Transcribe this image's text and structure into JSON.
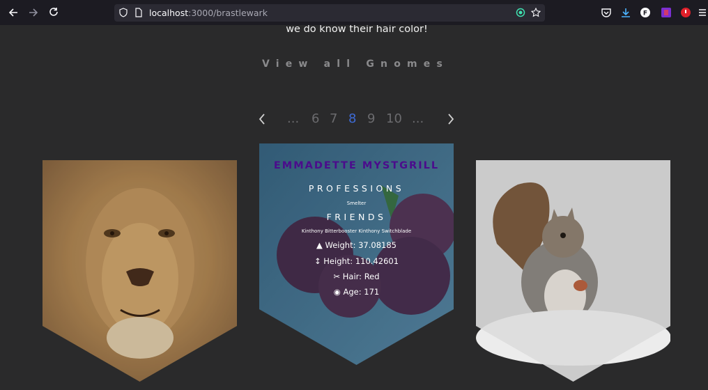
{
  "browser": {
    "url_host": "localhost",
    "url_rest": ":3000/brastlewark"
  },
  "page": {
    "lead_text": "we do know their hair color!",
    "view_all_label": "View all Gnomes"
  },
  "pagination": {
    "prev_icon": "chevron-left-icon",
    "next_icon": "chevron-right-icon",
    "items": [
      "...",
      "6",
      "7",
      "8",
      "9",
      "10",
      "..."
    ],
    "active": "8"
  },
  "cards": {
    "left": {
      "image": "lion photo"
    },
    "center": {
      "name": "EMMADETTE MYSTGRILL",
      "professions_title": "PROFESSIONS",
      "professions": "Smelter",
      "friends_title": "FRIENDS",
      "friends": "Kinthony Bitterbooster Kinthony Switchblade",
      "weight": "Weight: 37.08185",
      "height": "Height: 110.42601",
      "hair": "Hair: Red",
      "age": "Age: 171"
    },
    "right": {
      "image": "squirrel photo"
    }
  },
  "colors": {
    "accent_name": "#4b0c8c",
    "active_page": "#3e6bd6"
  }
}
